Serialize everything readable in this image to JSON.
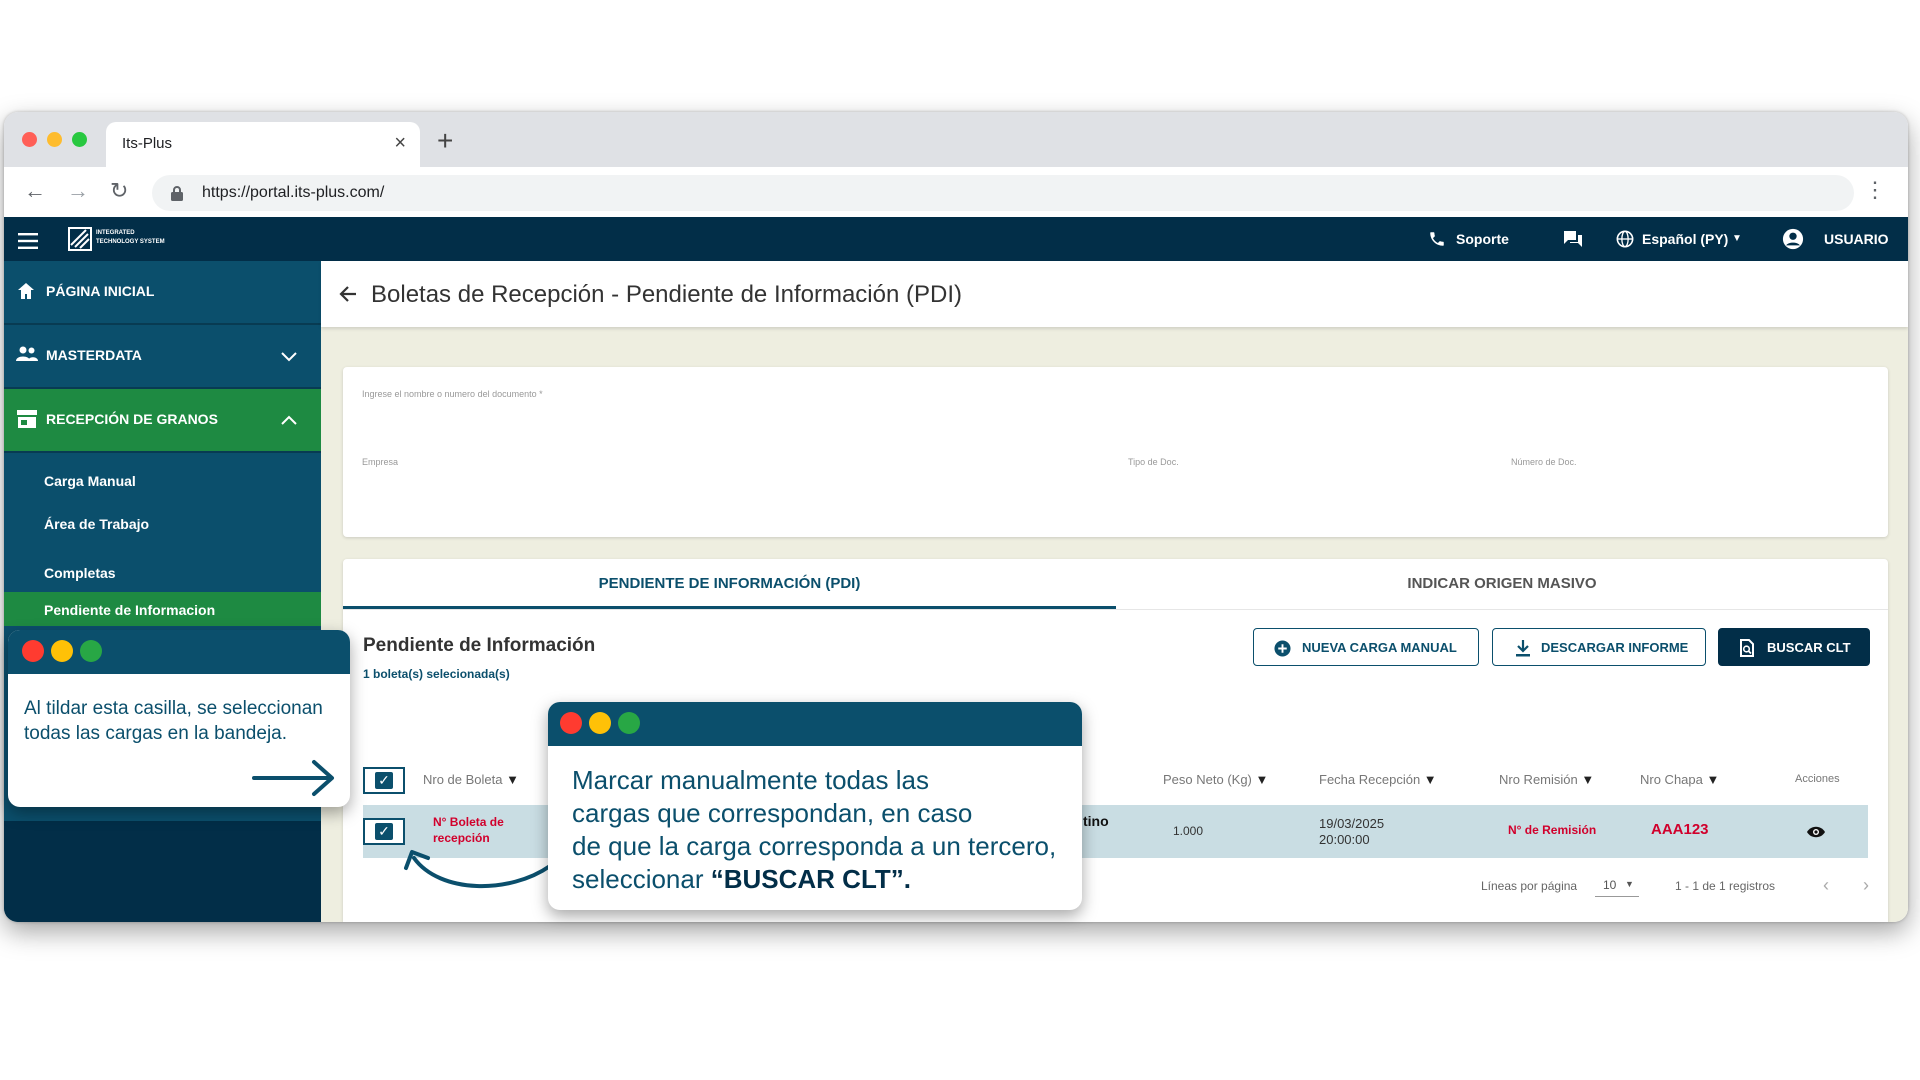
{
  "browser": {
    "tab_title": "Its-Plus",
    "url": "https://portal.its-plus.com/"
  },
  "topnav": {
    "logo_text_1": "INTEGRATED",
    "logo_text_2": "TECHNOLOGY SYSTEM",
    "support": "Soporte",
    "language": "Español (PY)",
    "user": "USUARIO"
  },
  "sidebar": {
    "home": "PÁGINA INICIAL",
    "masterdata": "MASTERDATA",
    "reception": "RECEPCIÓN DE GRANOS",
    "subitems": [
      "Carga Manual",
      "Área de Trabajo",
      "Completas",
      "Pendiente de Informacion"
    ]
  },
  "page": {
    "title": "Boletas de Recepción - Pendiente de Información (PDI)"
  },
  "filters": {
    "search_label": "Ingrese el nombre o numero del documento *",
    "company_label": "Empresa",
    "doc_type_label": "Tipo de Doc.",
    "doc_number_label": "Número de Doc."
  },
  "tabs": [
    "PENDIENTE DE INFORMACIÓN (PDI)",
    "INDICAR ORIGEN MASIVO"
  ],
  "section": {
    "title": "Pendiente de Información",
    "selected_count": "1 boleta(s) selecionada(s)"
  },
  "buttons": {
    "new_manual": "NUEVA CARGA MANUAL",
    "download": "DESCARGAR INFORME",
    "search_clt": "BUSCAR CLT"
  },
  "table": {
    "headers": [
      "Nro de Boleta",
      "Peso Neto (Kg)",
      "Fecha Recepción",
      "Nro Remisión",
      "Nro Chapa",
      "Acciones"
    ],
    "row": {
      "boleta_1": "N° Boleta de",
      "boleta_2": "recepción",
      "partial": "tino",
      "peso": "1.000",
      "fecha_1": "19/03/2025",
      "fecha_2": "20:00:00",
      "remision": "N° de Remisión",
      "chapa": "AAA123"
    }
  },
  "pagination": {
    "label": "Líneas por página",
    "per_page": "10",
    "range": "1 - 1 de 1 registros"
  },
  "callout_left": {
    "text": "Al tildar esta casilla, se seleccionan todas las cargas en la bandeja."
  },
  "callout_center": {
    "line_1": "Marcar manualmente todas las",
    "line_2": "cargas que correspondan, en caso",
    "line_3": "de que la carga corresponda a un tercero,",
    "line_4_pre": "seleccionar ",
    "line_4_bold": "“BUSCAR CLT”."
  },
  "colors": {
    "navy": "#022e48",
    "teal": "#0b4f6c",
    "green": "#1e8a42",
    "beige": "#eeeee0",
    "highlight_row": "#c9dde3",
    "red_text": "#d1002c"
  }
}
